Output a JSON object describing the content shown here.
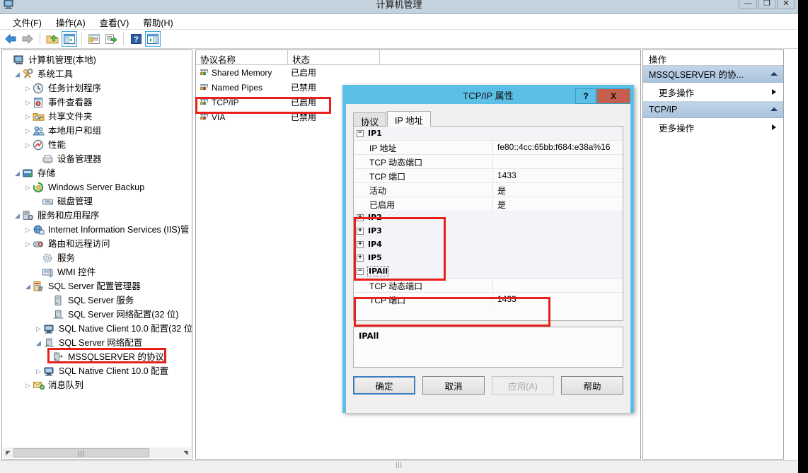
{
  "window": {
    "title": "计算机管理",
    "buttons": [
      {
        "name": "minimize",
        "glyph": "—"
      },
      {
        "name": "maximize",
        "glyph": "❐"
      },
      {
        "name": "close",
        "glyph": "✕"
      }
    ]
  },
  "menubar": {
    "items": [
      "文件(F)",
      "操作(A)",
      "查看(V)",
      "帮助(H)"
    ]
  },
  "toolbar": {
    "items": [
      {
        "name": "back-arrow-icon",
        "boxed": false
      },
      {
        "name": "forward-arrow-icon",
        "boxed": false
      },
      {
        "name": "up-folder-icon",
        "boxed": false
      },
      {
        "name": "show-console-tree-icon",
        "boxed": true
      },
      {
        "name": "properties-icon",
        "boxed": false
      },
      {
        "name": "export-list-icon",
        "boxed": false
      },
      {
        "name": "help-icon",
        "boxed": false
      },
      {
        "name": "show-action-pane-icon",
        "boxed": true
      }
    ]
  },
  "tree": {
    "nodes": [
      {
        "label": "计算机管理(本地)",
        "indent": 0,
        "twisty": "none",
        "icon": "computer-icon"
      },
      {
        "label": "系统工具",
        "indent": 1,
        "twisty": "open",
        "icon": "tools-icon"
      },
      {
        "label": "任务计划程序",
        "indent": 2,
        "twisty": "closed",
        "icon": "clock-icon"
      },
      {
        "label": "事件查看器",
        "indent": 2,
        "twisty": "closed",
        "icon": "event-viewer-icon"
      },
      {
        "label": "共享文件夹",
        "indent": 2,
        "twisty": "closed",
        "icon": "shared-folder-icon"
      },
      {
        "label": "本地用户和组",
        "indent": 2,
        "twisty": "closed",
        "icon": "users-icon"
      },
      {
        "label": "性能",
        "indent": 2,
        "twisty": "closed",
        "icon": "performance-icon"
      },
      {
        "label": "设备管理器",
        "indent": 2,
        "twisty": "none",
        "icon": "device-manager-icon"
      },
      {
        "label": "存储",
        "indent": 1,
        "twisty": "open",
        "icon": "storage-icon"
      },
      {
        "label": "Windows Server Backup",
        "indent": 2,
        "twisty": "closed",
        "icon": "backup-icon"
      },
      {
        "label": "磁盘管理",
        "indent": 2,
        "twisty": "none",
        "icon": "disk-icon"
      },
      {
        "label": "服务和应用程序",
        "indent": 1,
        "twisty": "open",
        "icon": "services-apps-icon"
      },
      {
        "label": "Internet Information Services (IIS)管",
        "indent": 2,
        "twisty": "closed",
        "icon": "iis-icon"
      },
      {
        "label": "路由和远程访问",
        "indent": 2,
        "twisty": "closed",
        "icon": "routing-icon"
      },
      {
        "label": "服务",
        "indent": 2,
        "twisty": "none",
        "icon": "gear-icon"
      },
      {
        "label": "WMI 控件",
        "indent": 2,
        "twisty": "none",
        "icon": "wmi-icon"
      },
      {
        "label": "SQL Server 配置管理器",
        "indent": 2,
        "twisty": "open",
        "icon": "sql-config-icon"
      },
      {
        "label": "SQL Server 服务",
        "indent": 3,
        "twisty": "none",
        "icon": "sql-service-icon"
      },
      {
        "label": "SQL Server 网络配置(32 位)",
        "indent": 3,
        "twisty": "none",
        "icon": "network-config-icon"
      },
      {
        "label": "SQL Native Client 10.0 配置(32 位",
        "indent": 3,
        "twisty": "closed",
        "icon": "native-client-icon"
      },
      {
        "label": "SQL Server 网络配置",
        "indent": 3,
        "twisty": "open",
        "icon": "network-config-icon"
      },
      {
        "label": "MSSQLSERVER 的协议",
        "indent": 4,
        "twisty": "none",
        "icon": "protocols-icon",
        "selected": true
      },
      {
        "label": "SQL Native Client 10.0 配置",
        "indent": 3,
        "twisty": "closed",
        "icon": "native-client-icon"
      },
      {
        "label": "消息队列",
        "indent": 2,
        "twisty": "closed",
        "icon": "message-queue-icon"
      }
    ],
    "hscroll": {
      "left_glyph": "◤",
      "right_glyph": "◥",
      "thumb_glyph": "|||"
    }
  },
  "list": {
    "columns": [
      "协议名称",
      "状态"
    ],
    "rows": [
      {
        "name": "Shared Memory",
        "state": "已启用",
        "highlighted": false
      },
      {
        "name": "Named Pipes",
        "state": "已禁用",
        "highlighted": false
      },
      {
        "name": "TCP/IP",
        "state": "已启用",
        "highlighted": true
      },
      {
        "name": "VIA",
        "state": "已禁用",
        "highlighted": false
      }
    ]
  },
  "actions": {
    "title": "操作",
    "groups": [
      {
        "label": "MSSQLSERVER 的协...",
        "items": [
          "更多操作"
        ]
      },
      {
        "label": "TCP/IP",
        "items": [
          "更多操作"
        ]
      }
    ]
  },
  "dialog": {
    "title": "TCP/IP 属性",
    "title_buttons": [
      {
        "name": "help-button",
        "glyph": "?"
      },
      {
        "name": "close-button",
        "glyph": "X"
      }
    ],
    "tabs": [
      {
        "label": "协议",
        "active": false
      },
      {
        "label": "IP 地址",
        "active": true
      }
    ],
    "sections": [
      {
        "name": "IP1",
        "expanded": true,
        "rows": [
          {
            "key": "IP 地址",
            "value": "fe80::4cc:65bb:f684:e38a%16"
          },
          {
            "key": "TCP 动态端口",
            "value": ""
          },
          {
            "key": "TCP 端口",
            "value": "1433"
          },
          {
            "key": "活动",
            "value": "是"
          },
          {
            "key": "已启用",
            "value": "是"
          }
        ]
      },
      {
        "name": "IP2",
        "expanded": false,
        "rows": []
      },
      {
        "name": "IP3",
        "expanded": false,
        "rows": []
      },
      {
        "name": "IP4",
        "expanded": false,
        "rows": []
      },
      {
        "name": "IP5",
        "expanded": false,
        "rows": []
      },
      {
        "name": "IPAll",
        "expanded": true,
        "selected": true,
        "rows": [
          {
            "key": "TCP 动态端口",
            "value": ""
          },
          {
            "key": "TCP 端口",
            "value": "1433"
          }
        ]
      }
    ],
    "description": "IPAll",
    "buttons": [
      {
        "label": "确定",
        "style": "default"
      },
      {
        "label": "取消",
        "style": "normal"
      },
      {
        "label": "应用(A)",
        "style": "disabled"
      },
      {
        "label": "帮助",
        "style": "normal"
      }
    ]
  },
  "annotations": {
    "color": "#e8201c",
    "boxes": [
      {
        "name": "tcpip-row-highlight"
      },
      {
        "name": "mssqlserver-protocols-highlight"
      },
      {
        "name": "ip2-ip5-highlight"
      },
      {
        "name": "ipall-ports-highlight"
      }
    ]
  }
}
